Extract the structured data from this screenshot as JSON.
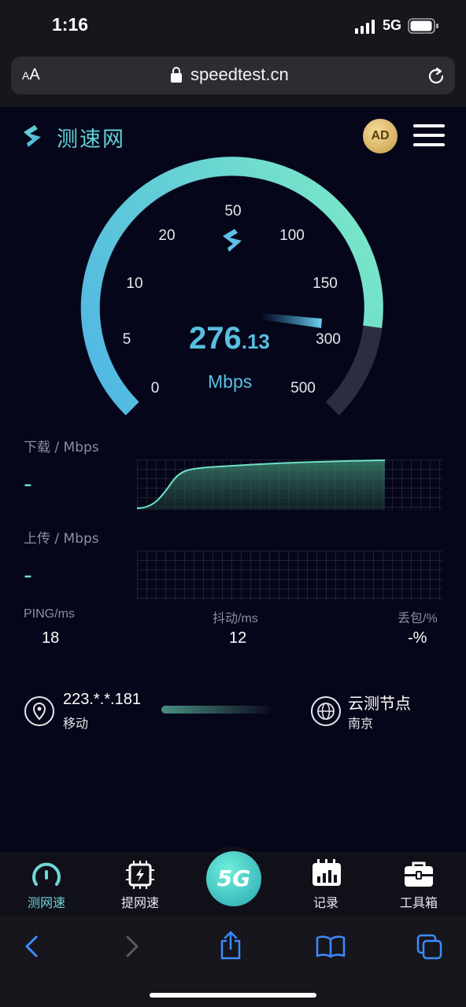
{
  "status_bar": {
    "time": "1:16",
    "network": "5G"
  },
  "browser": {
    "aa_small": "A",
    "aa_large": "A",
    "url": "speedtest.cn"
  },
  "header": {
    "logo_text": "测速网",
    "ad_badge": "AD"
  },
  "gauge": {
    "ticks": [
      "0",
      "5",
      "10",
      "20",
      "50",
      "100",
      "150",
      "300",
      "500"
    ],
    "speed_int": "276",
    "speed_dec": ".13",
    "unit": "Mbps",
    "needle_value": 276.13
  },
  "download": {
    "label": "下载 / Mbps",
    "value": "-"
  },
  "upload": {
    "label": "上传 / Mbps",
    "value": "-"
  },
  "stats": {
    "ping_label": "PING/ms",
    "ping_value": "18",
    "jitter_label": "抖动/ms",
    "jitter_value": "12",
    "loss_label": "丢包/%",
    "loss_value": "-%"
  },
  "client": {
    "ip": "223.*.*.181",
    "isp": "移动"
  },
  "server": {
    "name": "云测节点",
    "city": "南京"
  },
  "bottom_nav": {
    "items": [
      {
        "label": "测网速",
        "icon": "speedometer-icon",
        "active": true
      },
      {
        "label": "提网速",
        "icon": "chip-boost-icon",
        "active": false
      },
      {
        "label": "5G",
        "icon": "5g-icon",
        "active": false
      },
      {
        "label": "记录",
        "icon": "calendar-chart-icon",
        "active": false
      },
      {
        "label": "工具箱",
        "icon": "toolbox-icon",
        "active": false
      }
    ]
  },
  "colors": {
    "accent_cyan": "#59bfe0",
    "accent_green": "#6fe0c4",
    "active_tab": "#6fd6d6",
    "safari_blue": "#3d8bff"
  }
}
